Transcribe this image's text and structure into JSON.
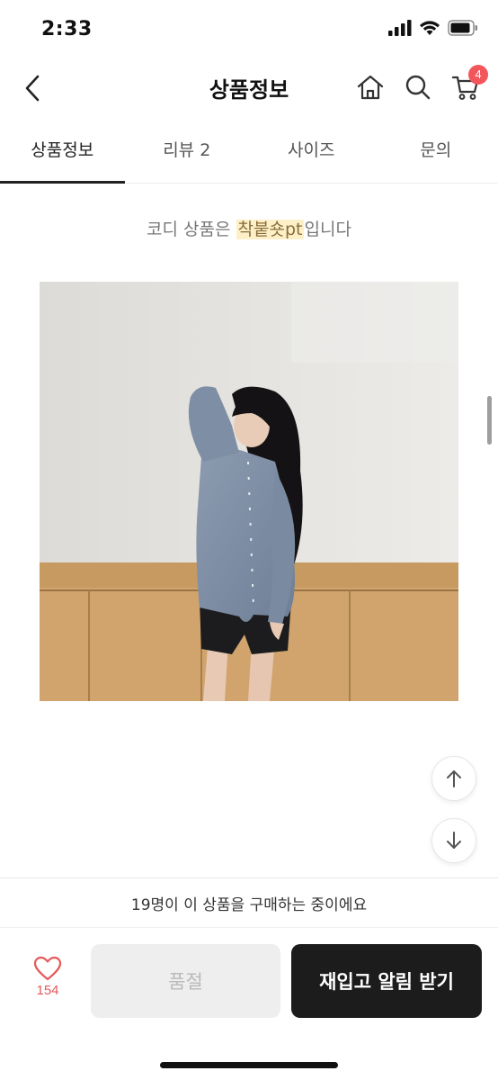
{
  "status_bar": {
    "time": "2:33",
    "icons": [
      "signal-icon",
      "wifi-icon",
      "battery-icon"
    ]
  },
  "header": {
    "title": "상품정보",
    "back_icon": "chevron-left-icon",
    "home_icon": "home-icon",
    "search_icon": "search-icon",
    "cart_icon": "cart-icon",
    "cart_badge": "4",
    "badge_color": "#f2555a"
  },
  "tabs": [
    {
      "label": "상품정보",
      "active": true
    },
    {
      "label": "리뷰 2",
      "active": false
    },
    {
      "label": "사이즈",
      "active": false
    },
    {
      "label": "문의",
      "active": false
    }
  ],
  "content": {
    "notice_prefix": "코디 상품은 ",
    "notice_highlight": "착붙숏pt",
    "notice_suffix": "입니다",
    "image": "product-photo"
  },
  "floating": {
    "up_icon": "arrow-up-icon",
    "down_icon": "arrow-down-icon"
  },
  "bottom": {
    "buying_text": "19명이 이 상품을 구매하는 중이에요",
    "like_icon": "heart-icon",
    "like_count": "154",
    "soldout_label": "품절",
    "restock_label": "재입고 알림 받기",
    "accent_color": "#e45a5a",
    "primary_button_color": "#1c1c1c"
  }
}
